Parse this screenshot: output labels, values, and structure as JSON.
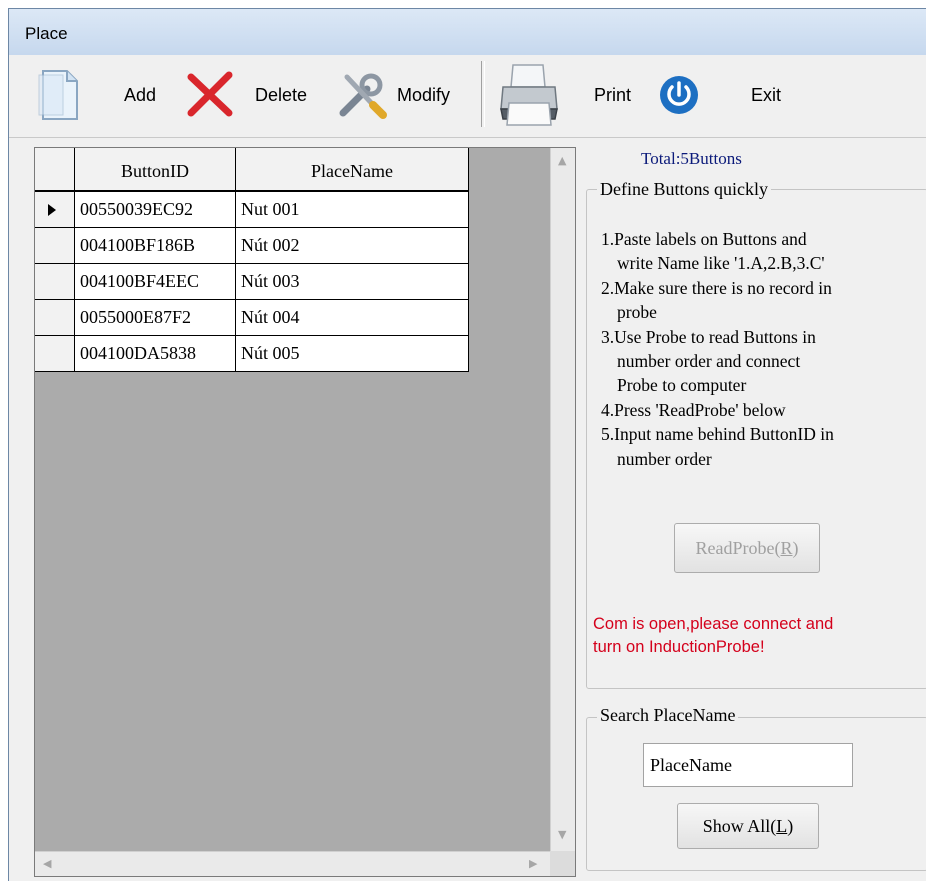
{
  "window": {
    "title": "Place"
  },
  "toolbar": {
    "add_label": "Add",
    "delete_label": "Delete",
    "modify_label": "Modify",
    "print_label": "Print",
    "exit_label": "Exit",
    "icons": {
      "add": "document-icon",
      "delete": "red-x-icon",
      "modify": "tools-icon",
      "print": "printer-icon",
      "exit": "power-icon"
    }
  },
  "grid": {
    "columns": [
      "ButtonID",
      "PlaceName"
    ],
    "rows": [
      {
        "button_id": "00550039EC92",
        "place_name": "Nut 001",
        "selected": true
      },
      {
        "button_id": "004100BF186B",
        "place_name": "Nút 002",
        "selected": false
      },
      {
        "button_id": "004100BF4EEC",
        "place_name": "Nút 003",
        "selected": false
      },
      {
        "button_id": "0055000E87F2",
        "place_name": "Nút 004",
        "selected": false
      },
      {
        "button_id": "004100DA5838",
        "place_name": "Nút 005",
        "selected": false
      }
    ]
  },
  "panel": {
    "total": "Total:5Buttons",
    "define_group_title": "Define Buttons quickly",
    "steps": {
      "s1a": "1.Paste labels on Buttons and",
      "s1b": "write Name like '1.A,2.B,3.C'",
      "s2a": "2.Make sure there is no record in",
      "s2b": "probe",
      "s3a": "3.Use Probe to read Buttons in",
      "s3b": "number order and connect",
      "s3c": "Probe to computer",
      "s4": "4.Press 'ReadProbe' below",
      "s5a": "5.Input name behind ButtonID in",
      "s5b": "number order"
    },
    "read_probe_label": "ReadProbe(",
    "read_probe_key": "R",
    "read_probe_close": ")",
    "status_line1": "Com is open,please connect and",
    "status_line2": "turn on InductionProbe!",
    "search_group_title": "Search PlaceName",
    "search_value": "PlaceName",
    "show_all_label": "Show All(",
    "show_all_key": "L",
    "show_all_close": ")"
  },
  "colors": {
    "status_text": "#d4001b",
    "total_text": "#0b1a7a",
    "delete_icon": "#d9262c",
    "exit_icon": "#1d6fc2"
  }
}
